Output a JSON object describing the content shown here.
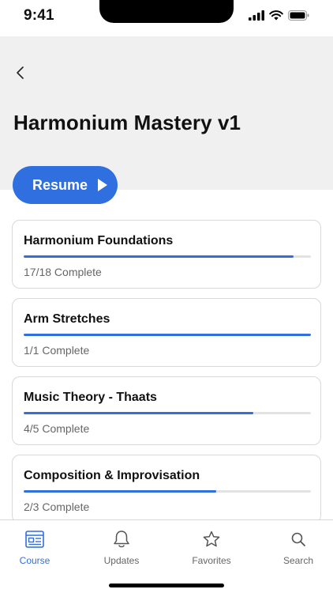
{
  "status_bar": {
    "time": "9:41"
  },
  "header": {
    "title": "Harmonium Mastery v1",
    "resume_label": "Resume"
  },
  "colors": {
    "accent": "#2f6fe0",
    "header_bg": "#f0f0f0"
  },
  "modules": [
    {
      "title": "Harmonium Foundations",
      "status": "17/18 Complete",
      "progress": 0.94
    },
    {
      "title": "Arm Stretches",
      "status": "1/1 Complete",
      "progress": 1.0
    },
    {
      "title": "Music Theory - Thaats",
      "status": "4/5 Complete",
      "progress": 0.8
    },
    {
      "title": "Composition & Improvisation",
      "status": "2/3 Complete",
      "progress": 0.67
    }
  ],
  "tabs": [
    {
      "label": "Course",
      "icon": "course-icon",
      "active": true
    },
    {
      "label": "Updates",
      "icon": "bell-icon",
      "active": false
    },
    {
      "label": "Favorites",
      "icon": "star-icon",
      "active": false
    },
    {
      "label": "Search",
      "icon": "search-icon",
      "active": false
    }
  ]
}
